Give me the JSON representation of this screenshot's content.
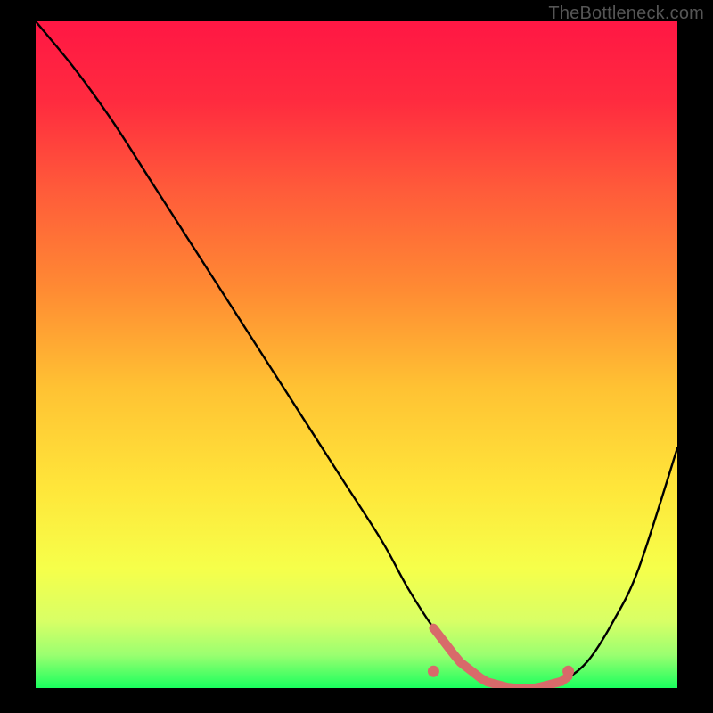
{
  "watermark": "TheBottleneck.com",
  "chart_data": {
    "type": "line",
    "title": "",
    "xlabel": "",
    "ylabel": "",
    "xlim": [
      0,
      100
    ],
    "ylim": [
      0,
      100
    ],
    "x": [
      0,
      6,
      12,
      18,
      24,
      30,
      36,
      42,
      48,
      54,
      58,
      62,
      66,
      70,
      74,
      78,
      82,
      86,
      90,
      94,
      100
    ],
    "values": [
      100,
      93,
      85,
      76,
      67,
      58,
      49,
      40,
      31,
      22,
      15,
      9,
      4,
      1,
      0,
      0,
      1,
      4,
      10,
      18,
      36
    ],
    "gradient_stops": [
      {
        "pos": 0.0,
        "color": "#ff1744"
      },
      {
        "pos": 0.12,
        "color": "#ff2b3f"
      },
      {
        "pos": 0.25,
        "color": "#ff5a3a"
      },
      {
        "pos": 0.4,
        "color": "#ff8a33"
      },
      {
        "pos": 0.55,
        "color": "#ffc233"
      },
      {
        "pos": 0.7,
        "color": "#ffe63a"
      },
      {
        "pos": 0.82,
        "color": "#f6ff4a"
      },
      {
        "pos": 0.9,
        "color": "#d8ff66"
      },
      {
        "pos": 0.95,
        "color": "#9bff70"
      },
      {
        "pos": 1.0,
        "color": "#1aff5e"
      }
    ],
    "highlight_band": {
      "x_start": 62,
      "x_end": 83,
      "color": "#d86a6a"
    },
    "highlight_endpoints": [
      {
        "x": 62,
        "y": 2.5
      },
      {
        "x": 83,
        "y": 2.5
      }
    ]
  }
}
